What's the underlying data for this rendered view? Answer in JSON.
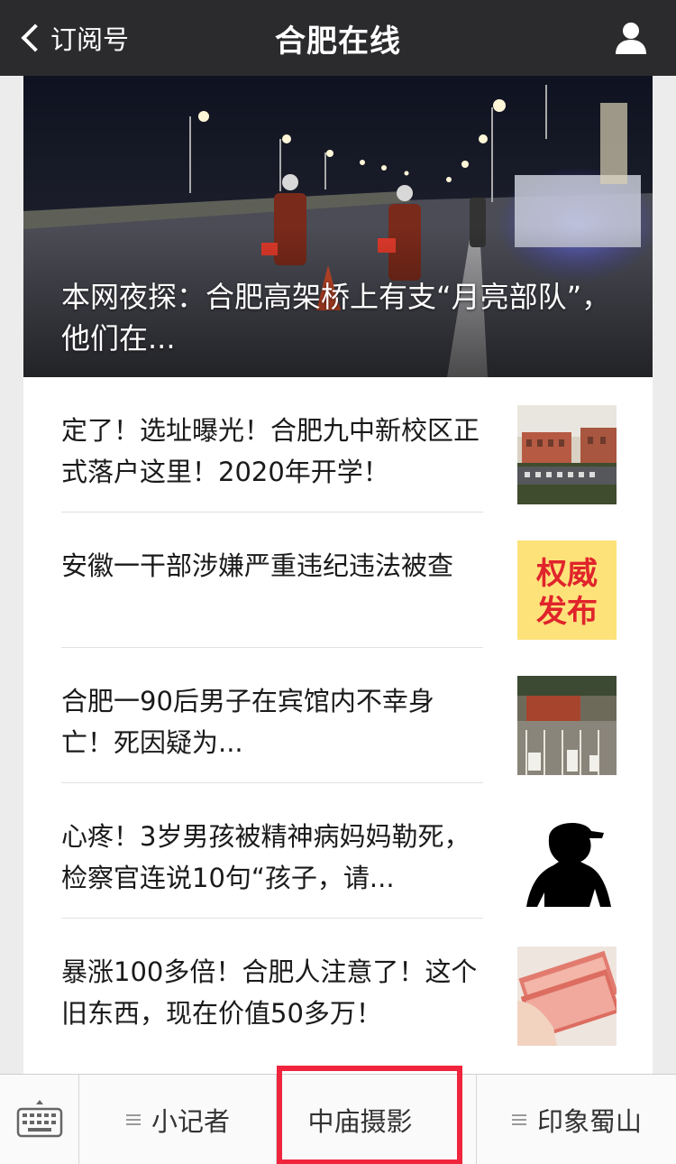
{
  "header": {
    "back_label": "订阅号",
    "title": "合肥在线",
    "back_icon": "chevron-left-icon",
    "profile_icon": "person-icon"
  },
  "hero": {
    "title": "本网夜探：合肥高架桥上有支“月亮部队”，他们在..."
  },
  "articles": [
    {
      "title": "定了！选址曝光！合肥九中新校区正式落户这里！2020年开学！",
      "thumb": "school-gate-photo"
    },
    {
      "title": "安徽一干部涉嫌严重违纪违法被查",
      "thumb": "badge",
      "badge_text": "权威发布"
    },
    {
      "title": "合肥一90后男子在宾馆内不幸身亡！死因疑为...",
      "thumb": "hotel-photo"
    },
    {
      "title": "心疼！3岁男孩被精神病妈妈勒死，检察官连说10句“孩子，请...",
      "thumb": "child-silhouette"
    },
    {
      "title": "暴涨100多倍！合肥人注意了！这个旧东西，现在价值50多万！",
      "thumb": "money-photo"
    }
  ],
  "menu": {
    "items": [
      "小记者",
      "中庙摄影",
      "印象蜀山"
    ],
    "keyboard_icon": "keyboard-icon",
    "menu_icon": "menu-lines-icon"
  },
  "colors": {
    "topbar": "#2b2b2d",
    "highlight": "#f0243d",
    "badge_bg": "#fde27a",
    "badge_text": "#e0242b"
  }
}
